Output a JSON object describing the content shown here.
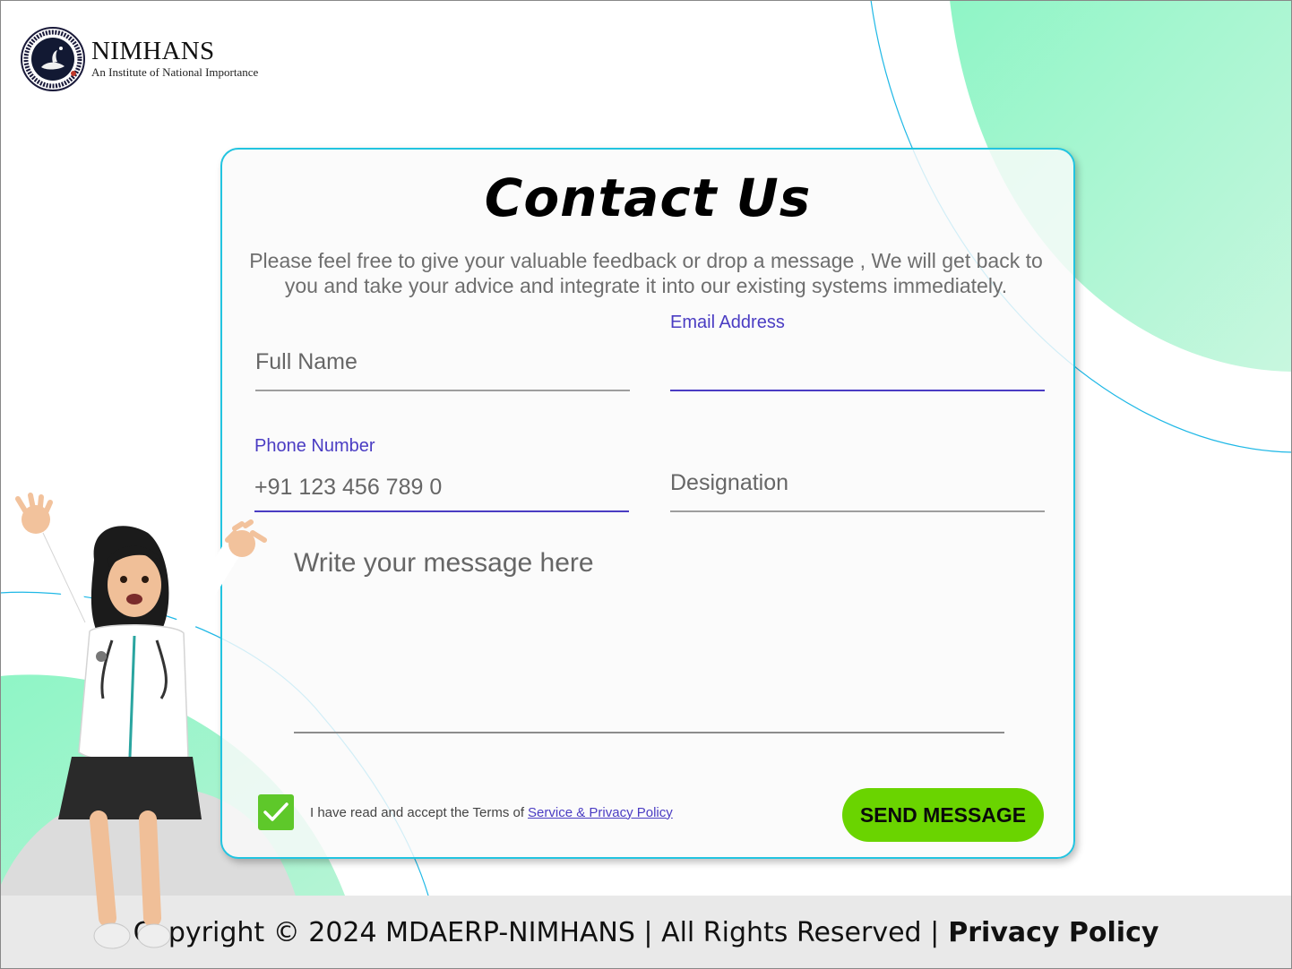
{
  "brand": {
    "name": "NIMHANS",
    "tagline": "An Institute of National Importance"
  },
  "contact": {
    "title": "Contact Us",
    "subtitle": "Please feel free to give your valuable feedback or drop a message , We will get back to you and take your advice and integrate it into our existing systems immediately.",
    "fields": {
      "full_name": {
        "placeholder": "Full Name"
      },
      "email": {
        "label": "Email Address",
        "value": ""
      },
      "phone": {
        "label": "Phone Number",
        "placeholder": "+91 123 456 789 0"
      },
      "designation": {
        "placeholder": "Designation"
      },
      "message": {
        "placeholder": "Write your message here"
      }
    },
    "terms": {
      "checked": true,
      "text": "I have read and accept the Terms of",
      "link": "Service & Privacy Policy"
    },
    "send_button": "SEND MESSAGE"
  },
  "footer": {
    "copyright": "Copyright © 2024 MDAERP-NIMHANS |  All Rights Reserved |",
    "privacy": "Privacy Policy"
  },
  "colors": {
    "accent_purple": "#4a3cc3",
    "card_border": "#22c4e0",
    "send_green": "#6ad400",
    "mint": "#8ff5c6"
  }
}
